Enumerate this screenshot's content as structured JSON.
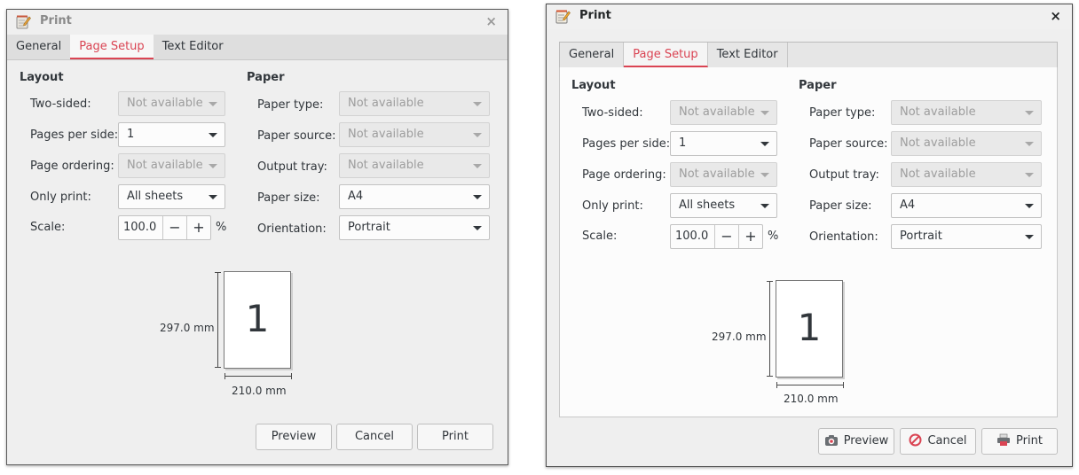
{
  "dialog": {
    "title": "Print",
    "close_glyph": "×",
    "tabs": [
      "General",
      "Page Setup",
      "Text Editor"
    ],
    "active_tab": "Page Setup",
    "layout": {
      "heading": "Layout",
      "two_sided": {
        "label": "Two-sided:",
        "value": "Not available"
      },
      "pages_per_side": {
        "label": "Pages per side:",
        "value": "1"
      },
      "page_ordering": {
        "label": "Page ordering:",
        "value": "Not available"
      },
      "only_print": {
        "label": "Only print:",
        "value": "All sheets"
      },
      "scale": {
        "label": "Scale:",
        "value": "100.0",
        "minus": "−",
        "plus": "+",
        "unit": "%"
      }
    },
    "paper": {
      "heading": "Paper",
      "paper_type": {
        "label": "Paper type:",
        "value": "Not available"
      },
      "paper_source": {
        "label": "Paper source:",
        "value": "Not available"
      },
      "output_tray": {
        "label": "Output tray:",
        "value": "Not available"
      },
      "paper_size": {
        "label": "Paper size:",
        "value": "A4"
      },
      "orientation": {
        "label": "Orientation:",
        "value": "Portrait"
      }
    },
    "preview": {
      "page_number": "1",
      "height": "297.0 mm",
      "width": "210.0 mm"
    },
    "buttons": {
      "preview": "Preview",
      "cancel": "Cancel",
      "print": "Print"
    }
  },
  "icons": {
    "app": "notepad-pencil-icon",
    "preview": "camera-preview-icon",
    "cancel": "cancel-circle-icon",
    "print": "printer-icon"
  },
  "colors": {
    "accent": "#da4453",
    "text": "#31363b",
    "disabled_text": "#9d9d9d"
  }
}
